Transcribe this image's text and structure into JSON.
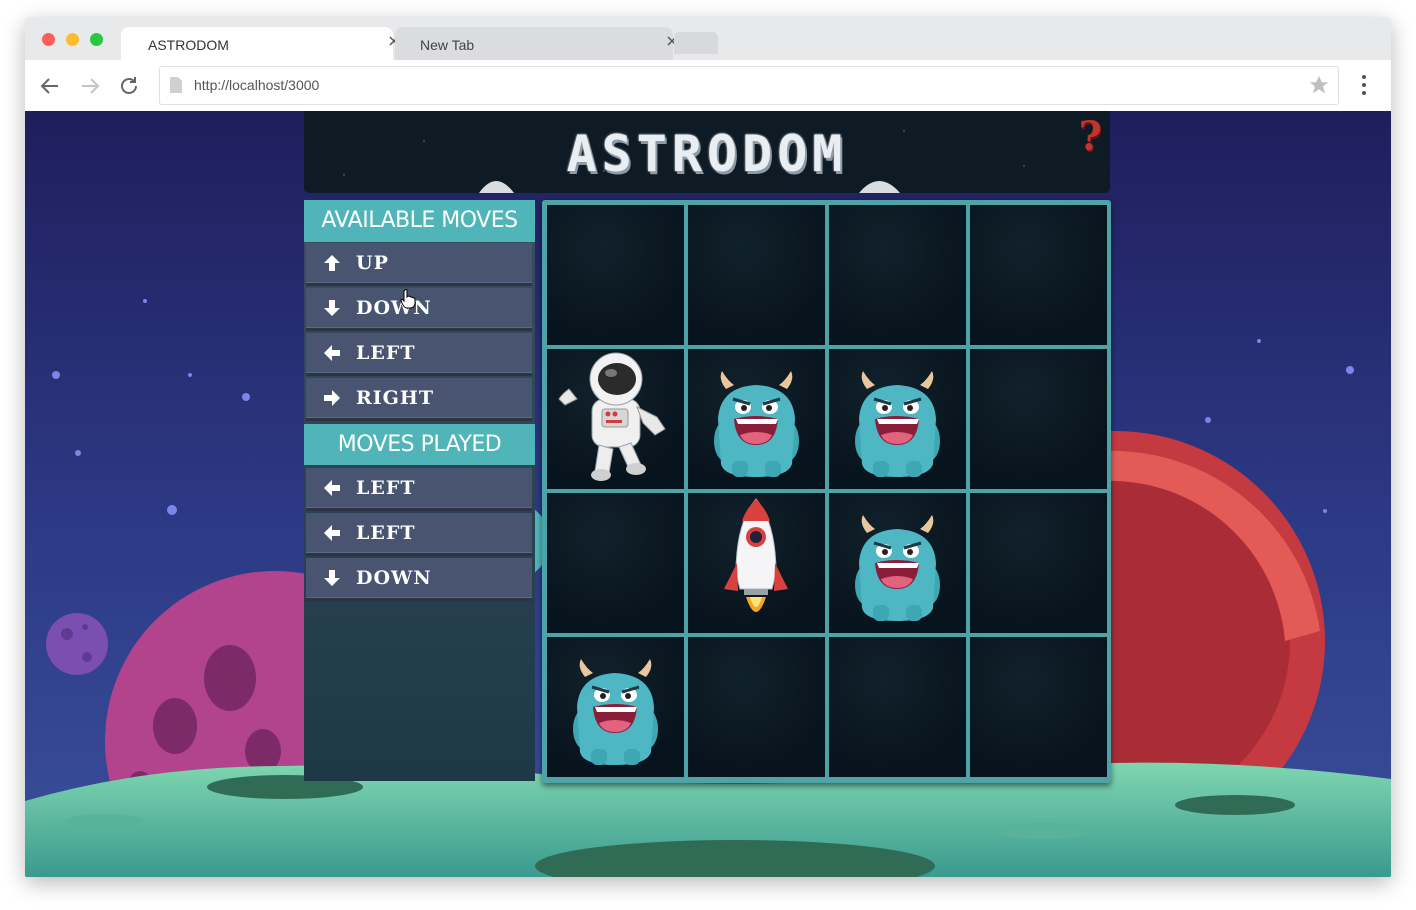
{
  "browser": {
    "tabs": [
      {
        "title": "ASTRODOM",
        "active": true
      },
      {
        "title": "New Tab",
        "active": false
      }
    ],
    "url": "http://localhost/3000"
  },
  "game": {
    "logo": "ASTRODOM",
    "help": "?",
    "available_moves": {
      "title": "AVAILABLE MOVES",
      "items": [
        {
          "label": "UP",
          "icon": "arrow-up-icon"
        },
        {
          "label": "DOWN",
          "icon": "arrow-down-icon"
        },
        {
          "label": "LEFT",
          "icon": "arrow-left-icon"
        },
        {
          "label": "RIGHT",
          "icon": "arrow-right-icon"
        }
      ]
    },
    "moves_played": {
      "title": "MOVES PLAYED",
      "items": [
        {
          "label": "LEFT",
          "icon": "arrow-left-icon"
        },
        {
          "label": "LEFT",
          "icon": "arrow-left-icon"
        },
        {
          "label": "DOWN",
          "icon": "arrow-down-icon"
        }
      ]
    },
    "board": {
      "rows": 4,
      "cols": 4,
      "cells": [
        [
          "empty",
          "empty",
          "empty",
          "empty"
        ],
        [
          "astronaut",
          "monster",
          "monster",
          "empty"
        ],
        [
          "empty",
          "rocket",
          "monster",
          "empty"
        ],
        [
          "monster",
          "empty",
          "empty",
          "empty"
        ]
      ]
    }
  },
  "colors": {
    "accent": "#4fb5b8",
    "button": "#485470",
    "board_border": "#4fa3a6",
    "help": "#c0342c",
    "monster": "#4fb7c3"
  }
}
